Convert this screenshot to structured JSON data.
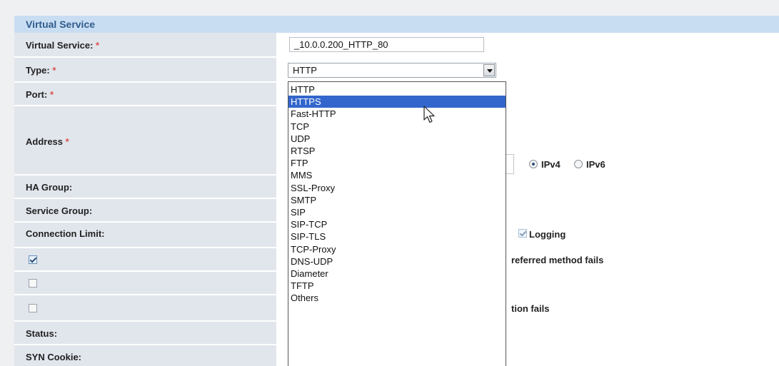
{
  "section": {
    "title": "Virtual Service"
  },
  "fields": {
    "virtual_service": {
      "label": "Virtual Service:",
      "required": "*",
      "value": "_10.0.0.200_HTTP_80"
    },
    "type": {
      "label": "Type:",
      "required": "*",
      "value": "HTTP"
    },
    "port": {
      "label": "Port:",
      "required": "*"
    },
    "address": {
      "label": "Address",
      "required": "*",
      "ipv4": "IPv4",
      "ipv6": "IPv6",
      "selected": "IPv4"
    },
    "ha_group": {
      "label": "HA Group:"
    },
    "service_group": {
      "label": "Service Group:"
    },
    "connection_limit": {
      "label": "Connection Limit:",
      "logging": "Logging"
    },
    "row_check_1": {
      "checked": true,
      "text": "referred method fails"
    },
    "row_check_2": {
      "checked": false
    },
    "row_check_3": {
      "checked": false,
      "text": "tion fails"
    },
    "status": {
      "label": "Status:"
    },
    "syn_cookie": {
      "label": "SYN Cookie:"
    }
  },
  "type_dropdown": {
    "highlighted": "HTTPS",
    "options": [
      "HTTP",
      "HTTPS",
      "Fast-HTTP",
      "TCP",
      "UDP",
      "RTSP",
      "FTP",
      "MMS",
      "SSL-Proxy",
      "SMTP",
      "SIP",
      "SIP-TCP",
      "SIP-TLS",
      "TCP-Proxy",
      "DNS-UDP",
      "Diameter",
      "TFTP",
      "Others"
    ]
  },
  "colors": {
    "header_bg": "#c9ddf2",
    "header_text": "#2f5b8d",
    "label_bg": "#e1e6ec",
    "highlight": "#3366cc",
    "required": "#d9534f"
  }
}
